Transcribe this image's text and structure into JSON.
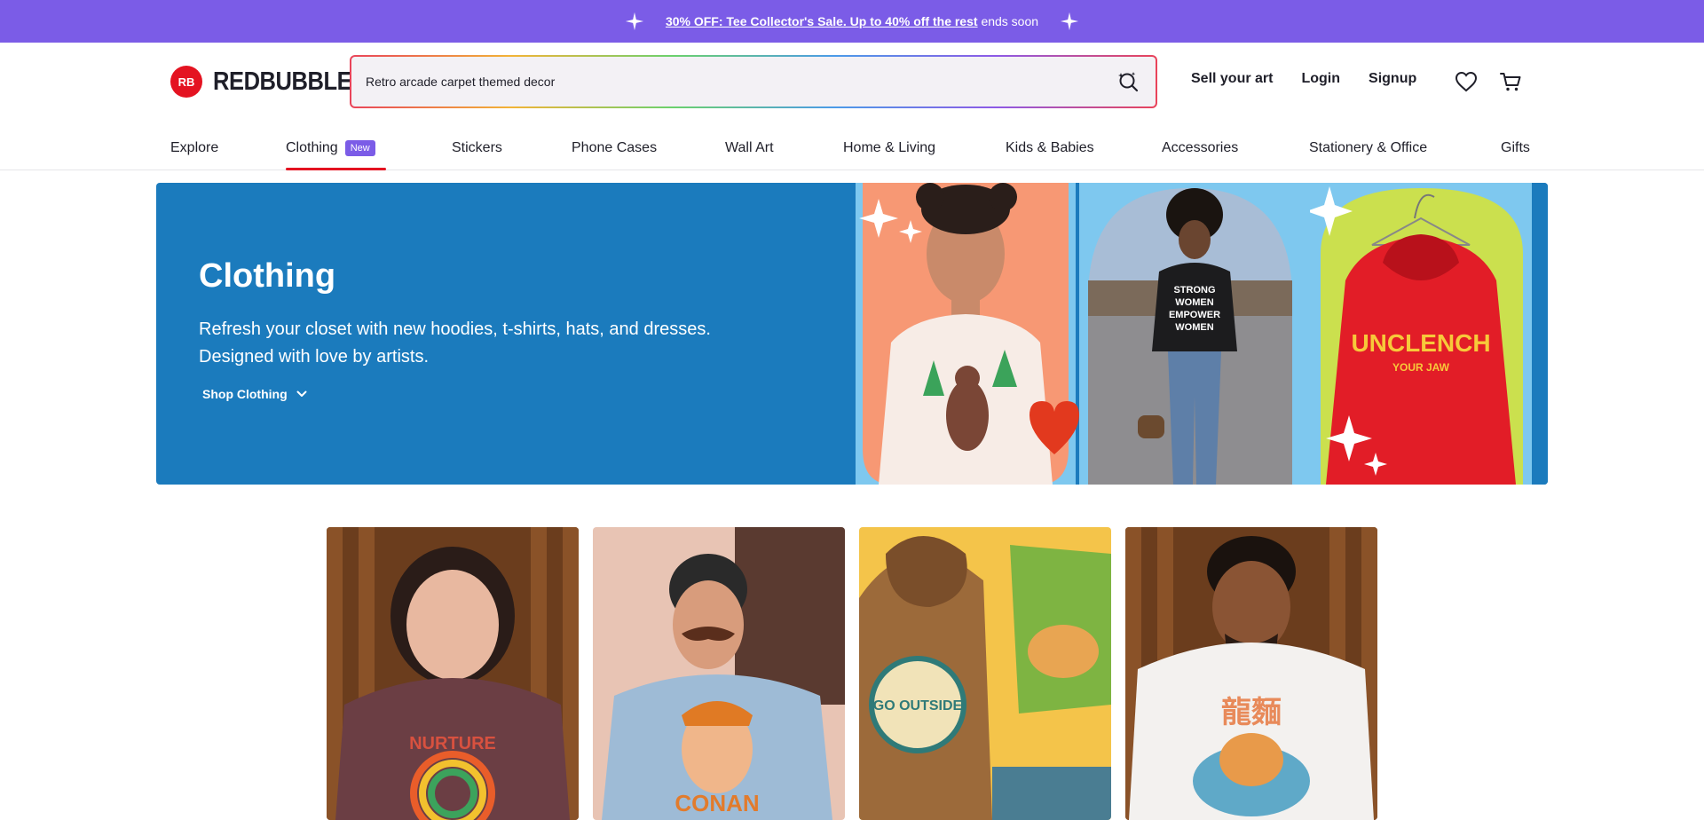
{
  "promo": {
    "link_text": "30% OFF: Tee Collector's Sale. Up to 40% off the rest",
    "suffix": "ends soon",
    "icon": "sparkle-icon"
  },
  "header": {
    "logo_mark": "RB",
    "logo_text": "REDBUBBLE",
    "search_value": "Retro arcade carpet themed decor",
    "links": {
      "sell": "Sell your art",
      "login": "Login",
      "signup": "Signup"
    },
    "icons": [
      "search-icon",
      "heart-icon",
      "cart-icon"
    ]
  },
  "nav": {
    "items": [
      "Explore",
      "Clothing",
      "Stickers",
      "Phone Cases",
      "Wall Art",
      "Home & Living",
      "Kids & Babies",
      "Accessories",
      "Stationery & Office",
      "Gifts"
    ],
    "badge": "New",
    "active": "Clothing"
  },
  "hero": {
    "title": "Clothing",
    "description_line1": "Refresh your closet with new hoodies, t-shirts, hats, and dresses.",
    "description_line2": "Designed with love by artists.",
    "shop_link": "Shop Clothing",
    "bg_color": "#1b7bbd",
    "shirt_texts": {
      "hoodie": "STRONG WOMEN EMPOWER WOMEN",
      "red_hoodie_line1": "UNCLENCH",
      "red_hoodie_line2": "YOUR JAW"
    }
  },
  "tiles": {
    "shirt_labels": [
      "NURTURE",
      "CONAN",
      "GO OUTSIDE",
      "龍麵"
    ]
  },
  "colors": {
    "accent": "#7b5ce7",
    "brand": "#e41321"
  }
}
